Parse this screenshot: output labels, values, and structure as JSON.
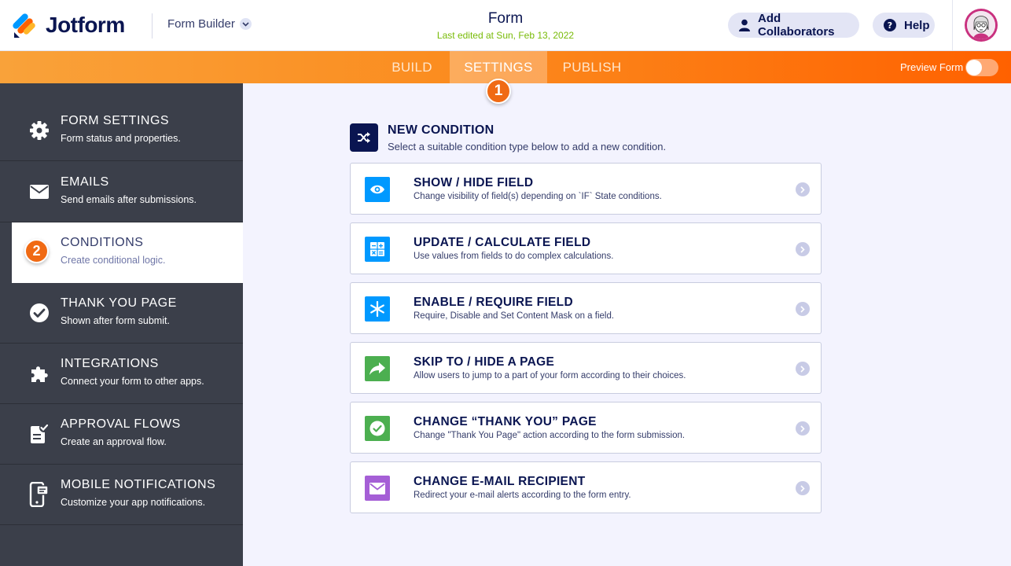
{
  "header": {
    "brand": "Jotform",
    "builder_label": "Form Builder",
    "form_title": "Form",
    "last_edited": "Last edited at Sun, Feb 13, 2022",
    "add_collaborators": "Add Collaborators",
    "help": "Help"
  },
  "nav": {
    "tabs": [
      {
        "label": "BUILD"
      },
      {
        "label": "SETTINGS"
      },
      {
        "label": "PUBLISH"
      }
    ],
    "active_tab": "SETTINGS",
    "preview_label": "Preview Form",
    "preview_on": false
  },
  "annotations": {
    "step1": "1",
    "step2": "2"
  },
  "sidebar": {
    "items": [
      {
        "title": "FORM SETTINGS",
        "subtitle": "Form status and properties.",
        "icon": "gear-icon"
      },
      {
        "title": "EMAILS",
        "subtitle": "Send emails after submissions.",
        "icon": "envelope-icon"
      },
      {
        "title": "CONDITIONS",
        "subtitle": "Create conditional logic.",
        "icon": "conditions-icon"
      },
      {
        "title": "THANK YOU PAGE",
        "subtitle": "Shown after form submit.",
        "icon": "check-circle-icon"
      },
      {
        "title": "INTEGRATIONS",
        "subtitle": "Connect your form to other apps.",
        "icon": "puzzle-icon"
      },
      {
        "title": "APPROVAL FLOWS",
        "subtitle": "Create an approval flow.",
        "icon": "approval-icon"
      },
      {
        "title": "MOBILE NOTIFICATIONS",
        "subtitle": "Customize your app notifications.",
        "icon": "mobile-icon"
      }
    ],
    "active_index": 2
  },
  "main": {
    "title": "NEW CONDITION",
    "subtitle": "Select a suitable condition type below to add a new condition.",
    "cards": [
      {
        "title": "SHOW / HIDE FIELD",
        "subtitle": "Change visibility of field(s) depending on `IF` State conditions.",
        "icon": "eye-icon",
        "color": "#0099ff"
      },
      {
        "title": "UPDATE / CALCULATE FIELD",
        "subtitle": "Use values from fields to do complex calculations.",
        "icon": "calculator-icon",
        "color": "#0099ff"
      },
      {
        "title": "ENABLE / REQUIRE FIELD",
        "subtitle": "Require, Disable and Set Content Mask on a field.",
        "icon": "asterisk-icon",
        "color": "#0099ff"
      },
      {
        "title": "SKIP TO / HIDE A PAGE",
        "subtitle": "Allow users to jump to a part of your form according to their choices.",
        "icon": "share-arrow-icon",
        "color": "#4caf50"
      },
      {
        "title": "CHANGE “THANK YOU” PAGE",
        "subtitle": "Change \"Thank You Page\" action according to the form submission.",
        "icon": "check-circle-icon",
        "color": "#4caf50"
      },
      {
        "title": "CHANGE E-MAIL RECIPIENT",
        "subtitle": "Redirect your e-mail alerts according to the form entry.",
        "icon": "envelope-icon",
        "color": "#a55fd6"
      }
    ]
  }
}
